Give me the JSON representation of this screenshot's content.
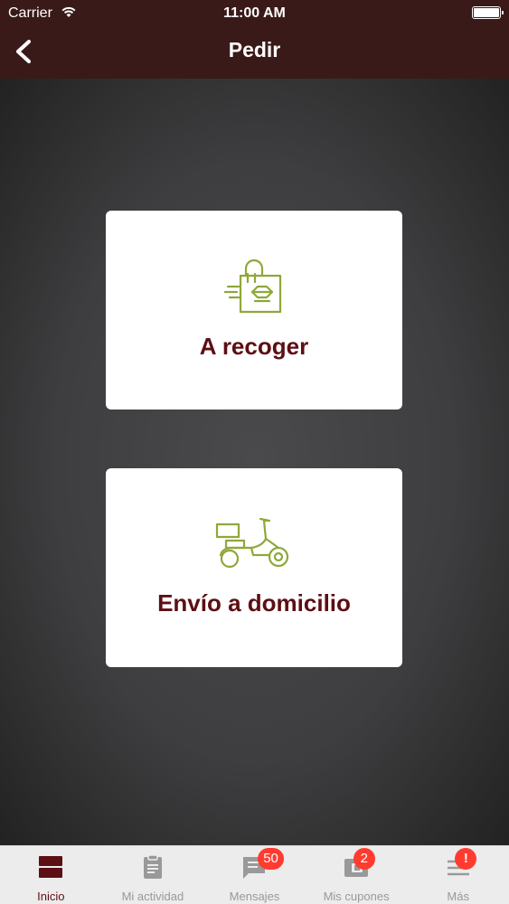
{
  "status_bar": {
    "carrier": "Carrier",
    "time": "11:00 AM"
  },
  "nav": {
    "title": "Pedir",
    "back_icon": "chevron-left-icon"
  },
  "options": [
    {
      "label": "A recoger",
      "icon": "pickup-bag-icon"
    },
    {
      "label": "Envío a domicilio",
      "icon": "delivery-scooter-icon"
    }
  ],
  "tabbar": {
    "tabs": [
      {
        "label": "Inicio",
        "icon": "home-icon",
        "active": true
      },
      {
        "label": "Mi actividad",
        "icon": "clipboard-icon"
      },
      {
        "label": "Mensajes",
        "icon": "message-icon",
        "badge": "50"
      },
      {
        "label": "Mis cupones",
        "icon": "coupon-icon",
        "badge": "2"
      },
      {
        "label": "Más",
        "icon": "menu-icon",
        "badge": "!"
      }
    ]
  },
  "colors": {
    "header_bg": "#3a1a18",
    "accent": "#5c0f14",
    "icon_green": "#8ea83a",
    "badge": "#ff3b30"
  }
}
